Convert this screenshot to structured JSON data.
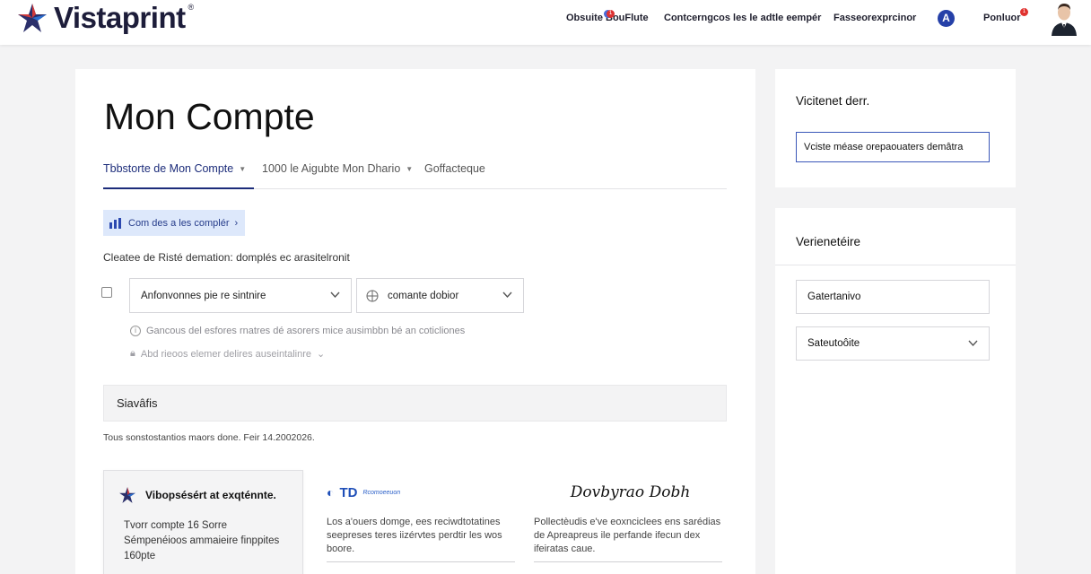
{
  "header": {
    "brand": "Vistaprint",
    "registered": "®",
    "nav": [
      {
        "label": "Obsuite BouFlute",
        "badge": "1"
      },
      {
        "label": "Contcerngcos les le adtle eempér"
      },
      {
        "label": "Fasseorexprcinor"
      },
      {
        "label": "Ponluor",
        "badge": "1"
      }
    ],
    "account_initial": "A"
  },
  "main": {
    "title": "Mon Compte",
    "tabs": [
      {
        "label": "Tbbstorte de Mon Compte"
      },
      {
        "label": "1000 le Aigubte Mon Dhario"
      },
      {
        "label": "Goffacteque"
      }
    ],
    "pill_label": "Com des a les complér",
    "info_line": "Cleatee de Risté demation: domplés ec arasitelronit",
    "select_1": "Anfonvonnes pie re sintnire",
    "select_2": "comante dobior",
    "hint_1": "Gancous del esfores rnatres dé asorers mice ausimbbn bé an coticliones",
    "hint_2": "Abd rieoos elemer delires auseintalinre",
    "section_bar": "Siavâfis",
    "footnote": "Tous sonstostantios maors done.   Feir 14.2002026.",
    "promo": {
      "title": "Vibopsésért at exqténnte.",
      "lines": [
        "Tvorr compte 16 Sorre",
        "Sémpenéioos ammaieire finppites",
        "160pte"
      ]
    },
    "col_1": {
      "logo": "TD",
      "logo_sub": "Rcomoeeuon",
      "text": "Los a'ouers domge, ees reciwdtotatines seepreses teres iizérvtes perdtir les wos boore."
    },
    "col_2": {
      "logo": "Dovbyrao Dobh",
      "text": "Pollectèudis e've eoxnciclees ens sarédias de Apreapreus ile perfande ifecun dex ifeiratas caue."
    }
  },
  "side_1": {
    "title": "Vicitenet derr.",
    "button": "Vciste méase orepaouaters demâtra"
  },
  "side_2": {
    "title": "Verienetéire",
    "field_1": "Gatertanivo",
    "field_2": "Sateutoôite"
  },
  "colors": {
    "accent": "#1c2c7a",
    "pill_bg": "#dde8fb",
    "badge": "#e0322f",
    "outline": "#3a57b8"
  }
}
